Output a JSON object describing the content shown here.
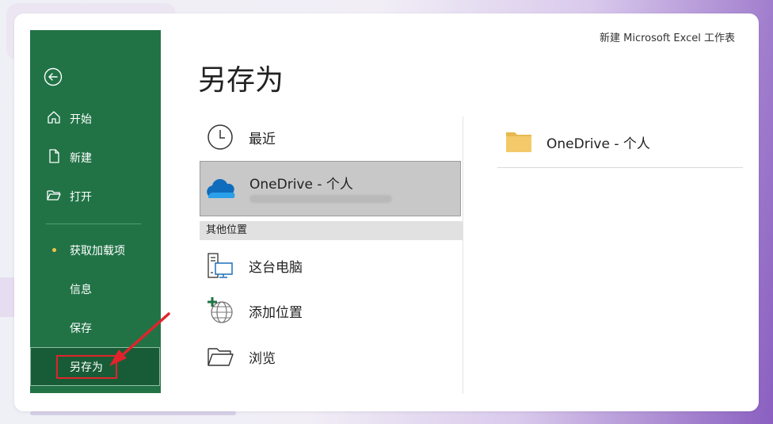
{
  "window": {
    "doc_title": "新建 Microsoft Excel 工作表"
  },
  "sidebar": {
    "back_icon": "back-arrow-icon",
    "items": [
      {
        "label": "开始",
        "icon": "home-icon"
      },
      {
        "label": "新建",
        "icon": "new-document-icon"
      },
      {
        "label": "打开",
        "icon": "open-folder-icon"
      },
      {
        "label": "获取加载项"
      },
      {
        "label": "信息"
      },
      {
        "label": "保存"
      }
    ],
    "active_item": {
      "label": "另存为"
    }
  },
  "main": {
    "title": "另存为",
    "locations": [
      {
        "label": "最近",
        "icon": "clock-icon"
      },
      {
        "label": "OneDrive - 个人",
        "icon": "onedrive-cloud-icon",
        "selected": true
      }
    ],
    "other_section_header": "其他位置",
    "other_locations": [
      {
        "label": "这台电脑",
        "icon": "this-pc-icon"
      },
      {
        "label": "添加位置",
        "icon": "add-location-globe-icon"
      },
      {
        "label": "浏览",
        "icon": "browse-folder-icon"
      }
    ],
    "right_folder": {
      "label": "OneDrive - 个人",
      "icon": "folder-icon"
    }
  },
  "colors": {
    "sidebar_bg": "#217346",
    "sidebar_active": "#185c37",
    "highlight_red": "#e0242b",
    "folder_yellow": "#f3c969",
    "onedrive_blue": "#0f6cbd"
  }
}
